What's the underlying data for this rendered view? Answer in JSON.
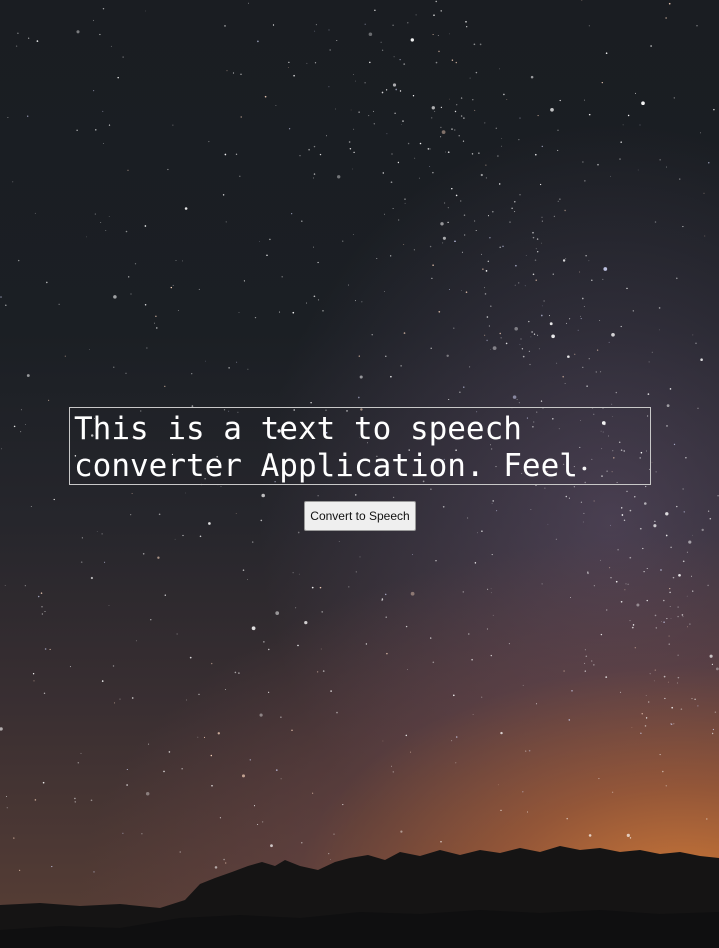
{
  "speech_app": {
    "text_input": {
      "value": "This is a text to speech converter Application. Feel"
    },
    "convert_button": {
      "label": "Convert to Speech"
    }
  },
  "colors": {
    "text": "#ffffff",
    "button_background": "#efefef",
    "sky_top": "#1a1d22",
    "horizon_glow": "#d67d37"
  }
}
